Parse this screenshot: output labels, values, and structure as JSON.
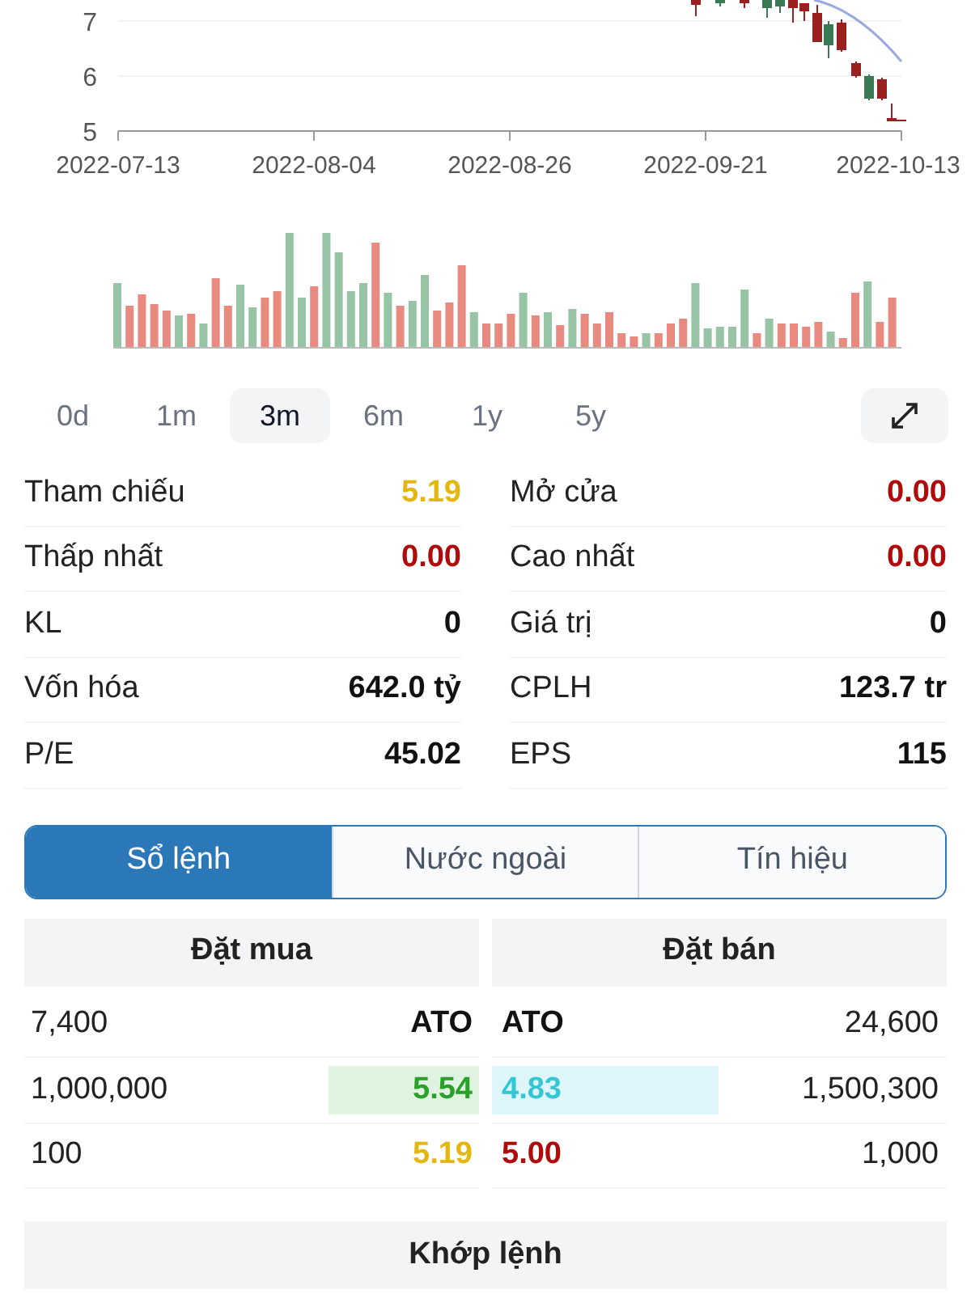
{
  "price_chart": {
    "y_labels": [
      "7",
      "6",
      "5"
    ],
    "x_labels": [
      "2022-07-13",
      "2022-08-04",
      "2022-08-26",
      "2022-09-21",
      "2022-10-13"
    ]
  },
  "periods": [
    {
      "label": "0d",
      "selected": false
    },
    {
      "label": "1m",
      "selected": false
    },
    {
      "label": "3m",
      "selected": true
    },
    {
      "label": "6m",
      "selected": false
    },
    {
      "label": "1y",
      "selected": false
    },
    {
      "label": "5y",
      "selected": false
    }
  ],
  "stats": [
    {
      "label": "Tham chiếu",
      "value": "5.19",
      "color": "#e3b70f"
    },
    {
      "label": "Mở cửa",
      "value": "0.00",
      "color": "#b00a0a"
    },
    {
      "label": "Thấp nhất",
      "value": "0.00",
      "color": "#b00a0a"
    },
    {
      "label": "Cao nhất",
      "value": "0.00",
      "color": "#b00a0a"
    },
    {
      "label": "KL",
      "value": "0",
      "color": "#111111"
    },
    {
      "label": "Giá trị",
      "value": "0",
      "color": "#111111"
    },
    {
      "label": "Vốn hóa",
      "value": "642.0 tỷ",
      "color": "#111111"
    },
    {
      "label": "CPLH",
      "value": "123.7 tr",
      "color": "#111111"
    },
    {
      "label": "P/E",
      "value": "45.02",
      "color": "#111111"
    },
    {
      "label": "EPS",
      "value": "115",
      "color": "#111111"
    }
  ],
  "tabs": [
    {
      "label": "Sổ lệnh",
      "selected": true
    },
    {
      "label": "Nước ngoài",
      "selected": false
    },
    {
      "label": "Tín hiệu",
      "selected": false
    }
  ],
  "order_book": {
    "bid_header": "Đặt mua",
    "ask_header": "Đặt bán",
    "bids": [
      {
        "volume": "7,400",
        "price": "ATO",
        "color": "#111111",
        "highlighted": false
      },
      {
        "volume": "1,000,000",
        "price": "5.54",
        "color": "#2aa02a",
        "highlighted": true
      },
      {
        "volume": "100",
        "price": "5.19",
        "color": "#e3b70f",
        "highlighted": false
      }
    ],
    "asks": [
      {
        "volume": "24,600",
        "price": "ATO",
        "color": "#111111",
        "highlighted": false
      },
      {
        "volume": "1,500,300",
        "price": "4.83",
        "color": "#35c6d6",
        "highlighted": true
      },
      {
        "volume": "1,000",
        "price": "5.00",
        "color": "#b00a0a",
        "highlighted": false
      }
    ]
  },
  "matched_header": "Khớp lệnh"
}
